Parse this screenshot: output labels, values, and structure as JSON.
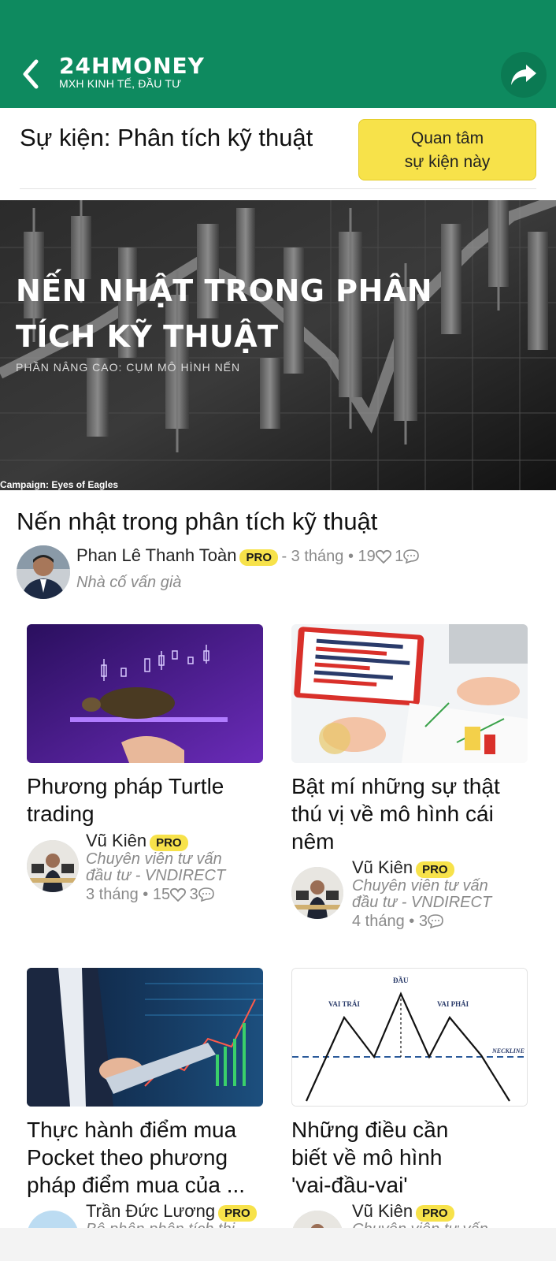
{
  "header": {
    "logo_main": "24HMONEY",
    "logo_sub": "MXH KINH TẾ, ĐẦU TƯ",
    "colors": {
      "bg": "#0e8a5f",
      "accent": "#f7e24a"
    }
  },
  "event": {
    "title": "Sự kiện: Phân tích kỹ thuật",
    "follow_line1": "Quan tâm",
    "follow_line2": "sự kiện này"
  },
  "banner": {
    "title_line1": "NẾN NHẬT TRONG PHÂN",
    "title_line2": "TÍCH KỸ THUẬT",
    "subtitle": "PHẦN NÂNG CAO: CỤM MÔ HÌNH NẾN",
    "campaign": "Campaign: Eyes of Eagles"
  },
  "main_article": {
    "title": "Nến nhật trong phân tích kỹ thuật",
    "author": "Phan Lê Thanh Toàn",
    "badge": "PRO",
    "time": "3 tháng",
    "likes": "19",
    "comments": "1",
    "role": "Nhà cố vấn già"
  },
  "cards": [
    {
      "title_lines": [
        "Phương pháp Turtle",
        "trading"
      ],
      "author": "Vũ Kiên",
      "badge": "PRO",
      "role_lines": [
        "Chuyên viên tư vấn",
        "đầu tư - VNDIRECT"
      ],
      "time": "3 tháng",
      "likes": "15",
      "comments": "3"
    },
    {
      "title_lines": [
        "Bật mí những sự thật",
        "thú vị về mô hình cái",
        "nêm"
      ],
      "author": "Vũ Kiên",
      "badge": "PRO",
      "role_lines": [
        "Chuyên viên tư vấn",
        "đầu tư - VNDIRECT"
      ],
      "time": "4 tháng",
      "comments": "3"
    },
    {
      "title_lines": [
        "Thực hành điểm mua",
        "Pocket theo phương",
        "pháp điểm mua của ..."
      ],
      "author": "Trần Đức Lương",
      "badge": "PRO",
      "role_lines": [
        "Bộ phận phân tích thị"
      ]
    },
    {
      "title_lines": [
        "Những điều cần",
        "biết về mô hình",
        "'vai-đầu-vai'"
      ],
      "author": "Vũ Kiên",
      "badge": "PRO",
      "role_lines": [
        "Chuyên viên tư vấn"
      ],
      "chart_labels": {
        "head": "ĐẦU",
        "left": "VAI TRÁI",
        "right": "VAI PHẢI",
        "neck": "NECKLINE"
      }
    }
  ]
}
